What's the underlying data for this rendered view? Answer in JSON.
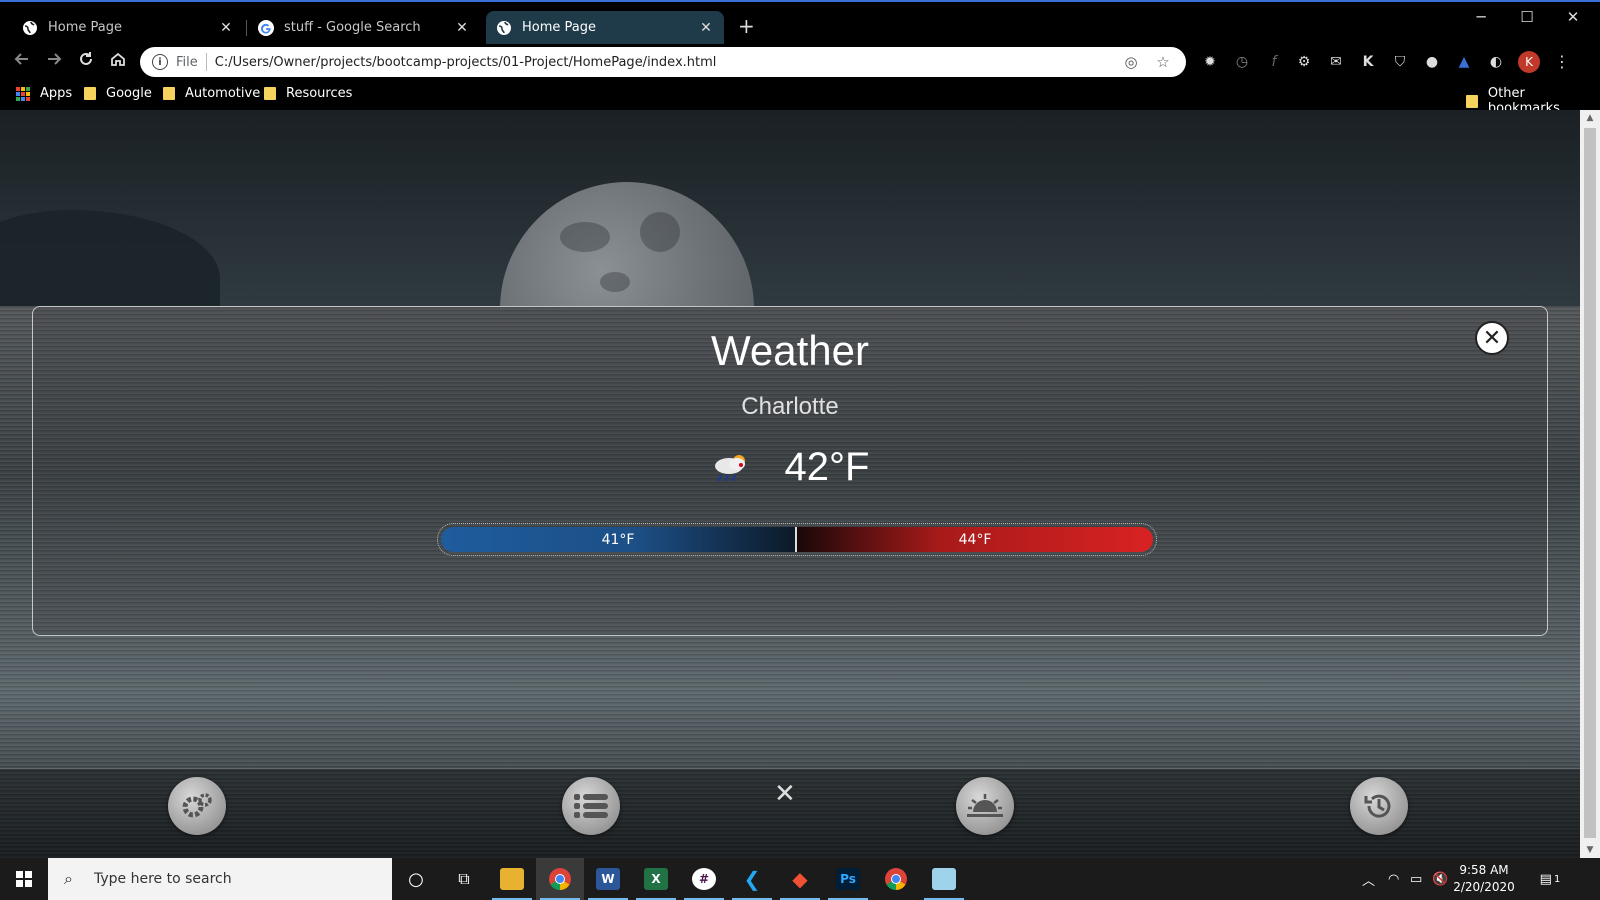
{
  "browser": {
    "tabs": [
      {
        "title": "Home Page",
        "active": false
      },
      {
        "title": "stuff - Google Search",
        "active": false
      },
      {
        "title": "Home Page",
        "active": true
      }
    ],
    "new_tab_label": "+",
    "window_controls": {
      "minimize": "─",
      "maximize": "☐",
      "close": "✕"
    },
    "omnibox": {
      "scheme": "File",
      "url": "C:/Users/Owner/projects/bootcamp-projects/01-Project/HomePage/index.html"
    },
    "profile_initial": "K",
    "bookmarks": [
      {
        "label": "Apps",
        "icon": "apps-grid-icon"
      },
      {
        "label": "Google",
        "icon": "folder-icon"
      },
      {
        "label": "Automotive",
        "icon": "folder-icon"
      },
      {
        "label": "Resources",
        "icon": "folder-icon"
      }
    ],
    "other_bookmarks": "Other bookmarks"
  },
  "weather": {
    "title": "Weather",
    "city": "Charlotte",
    "icon": "rain-cloud-icon",
    "current_temp": "42°F",
    "low_temp": "41°F",
    "high_temp": "44°F",
    "colors": {
      "low": "#1f5c9e",
      "high": "#d82222"
    }
  },
  "dock": {
    "buttons": [
      {
        "name": "settings",
        "icon": "gear-icon"
      },
      {
        "name": "list",
        "icon": "list-icon"
      },
      {
        "name": "weather",
        "icon": "sunrise-icon"
      },
      {
        "name": "history",
        "icon": "history-icon"
      }
    ],
    "close_label": "✕"
  },
  "taskbar": {
    "search_placeholder": "Type here to search",
    "time": "9:58 AM",
    "date": "2/20/2020",
    "notification_count": "1"
  }
}
